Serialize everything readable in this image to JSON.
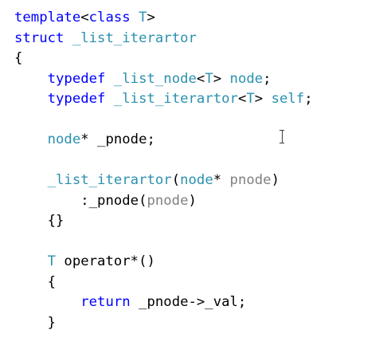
{
  "editor": {
    "lines": [
      [
        {
          "t": "template",
          "c": "kw"
        },
        {
          "t": "<",
          "c": "ident"
        },
        {
          "t": "class",
          "c": "kw"
        },
        {
          "t": " ",
          "c": "ident"
        },
        {
          "t": "T",
          "c": "type"
        },
        {
          "t": ">",
          "c": "ident"
        }
      ],
      [
        {
          "t": "struct",
          "c": "kw"
        },
        {
          "t": " ",
          "c": "ident"
        },
        {
          "t": "_list_iterartor",
          "c": "type"
        }
      ],
      [
        {
          "t": "{",
          "c": "ident"
        }
      ],
      [
        {
          "t": "    ",
          "c": "ident"
        },
        {
          "t": "typedef",
          "c": "kw"
        },
        {
          "t": " ",
          "c": "ident"
        },
        {
          "t": "_list_node",
          "c": "type"
        },
        {
          "t": "<",
          "c": "ident"
        },
        {
          "t": "T",
          "c": "type"
        },
        {
          "t": "> ",
          "c": "ident"
        },
        {
          "t": "node",
          "c": "type"
        },
        {
          "t": ";",
          "c": "ident"
        }
      ],
      [
        {
          "t": "    ",
          "c": "ident"
        },
        {
          "t": "typedef",
          "c": "kw"
        },
        {
          "t": " ",
          "c": "ident"
        },
        {
          "t": "_list_iterartor",
          "c": "type"
        },
        {
          "t": "<",
          "c": "ident"
        },
        {
          "t": "T",
          "c": "type"
        },
        {
          "t": "> ",
          "c": "ident"
        },
        {
          "t": "self",
          "c": "type"
        },
        {
          "t": ";",
          "c": "ident"
        }
      ],
      [],
      [
        {
          "t": "    ",
          "c": "ident"
        },
        {
          "t": "node",
          "c": "type"
        },
        {
          "t": "* _pnode;",
          "c": "ident"
        }
      ],
      [],
      [
        {
          "t": "    ",
          "c": "ident"
        },
        {
          "t": "_list_iterartor",
          "c": "type"
        },
        {
          "t": "(",
          "c": "ident"
        },
        {
          "t": "node",
          "c": "type"
        },
        {
          "t": "* ",
          "c": "ident"
        },
        {
          "t": "pnode",
          "c": "param"
        },
        {
          "t": ")",
          "c": "ident"
        }
      ],
      [
        {
          "t": "        :_pnode(",
          "c": "ident"
        },
        {
          "t": "pnode",
          "c": "param"
        },
        {
          "t": ")",
          "c": "ident"
        }
      ],
      [
        {
          "t": "    {}",
          "c": "ident"
        }
      ],
      [],
      [
        {
          "t": "    ",
          "c": "ident"
        },
        {
          "t": "T",
          "c": "type"
        },
        {
          "t": " operator*()",
          "c": "ident"
        }
      ],
      [
        {
          "t": "    {",
          "c": "ident"
        }
      ],
      [
        {
          "t": "        ",
          "c": "ident"
        },
        {
          "t": "return",
          "c": "kw"
        },
        {
          "t": " _pnode->_val;",
          "c": "ident"
        }
      ],
      [
        {
          "t": "    }",
          "c": "ident"
        }
      ]
    ]
  },
  "colors": {
    "keyword": "#0000ff",
    "type": "#2b91af",
    "identifier": "#000000",
    "parameter": "#808080",
    "background": "#ffffff"
  },
  "icons": {
    "cursor": "ibeam-cursor-icon"
  }
}
